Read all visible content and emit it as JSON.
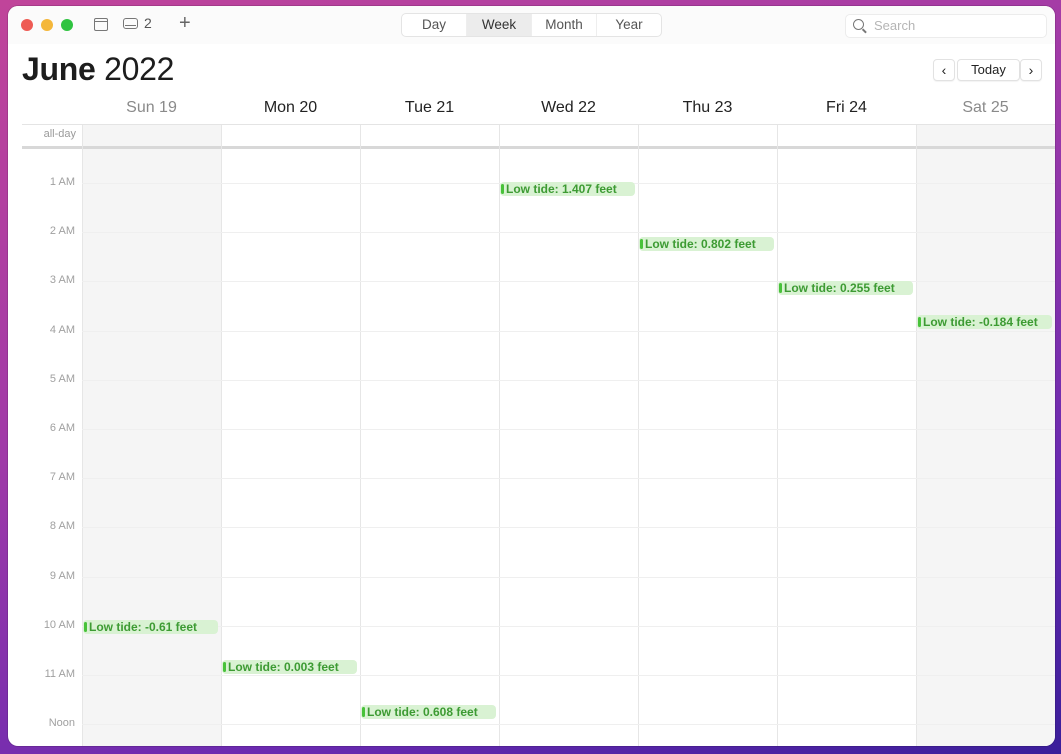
{
  "toolbar": {
    "inbox_count": "2",
    "add_label": "+",
    "icons": {
      "close": "close-traffic-light",
      "minimize": "minimize-traffic-light",
      "maximize": "zoom-traffic-light",
      "calendars": "calendar-list-icon",
      "inbox": "inbox-tray-icon",
      "add": "plus-icon",
      "search": "magnifying-glass-icon"
    },
    "views": [
      {
        "label": "Day",
        "active": false
      },
      {
        "label": "Week",
        "active": true
      },
      {
        "label": "Month",
        "active": false
      },
      {
        "label": "Year",
        "active": false
      }
    ],
    "search_placeholder": "Search"
  },
  "header": {
    "month": "June",
    "year": "2022",
    "prev_label": "‹",
    "today_label": "Today",
    "next_label": "›"
  },
  "week": {
    "days": [
      {
        "label": "Sun 19",
        "weekend": true
      },
      {
        "label": "Mon 20",
        "weekend": false
      },
      {
        "label": "Tue 21",
        "weekend": false
      },
      {
        "label": "Wed 22",
        "weekend": false
      },
      {
        "label": "Thu 23",
        "weekend": false
      },
      {
        "label": "Fri 24",
        "weekend": false
      },
      {
        "label": "Sat 25",
        "weekend": true
      }
    ],
    "allday_label": "all-day",
    "hours": [
      "1 AM",
      "2 AM",
      "3 AM",
      "4 AM",
      "5 AM",
      "6 AM",
      "7 AM",
      "8 AM",
      "9 AM",
      "10 AM",
      "11 AM",
      "Noon"
    ]
  },
  "events": [
    {
      "day": 0,
      "start_hour": 9.95,
      "title": "Low tide: -0.61 feet"
    },
    {
      "day": 1,
      "start_hour": 10.75,
      "title": "Low tide: 0.003 feet"
    },
    {
      "day": 2,
      "start_hour": 11.67,
      "title": "Low tide: 0.608 feet"
    },
    {
      "day": 3,
      "start_hour": 1.05,
      "title": "Low tide: 1.407 feet"
    },
    {
      "day": 4,
      "start_hour": 2.15,
      "title": "Low tide: 0.802 feet"
    },
    {
      "day": 5,
      "start_hour": 3.05,
      "title": "Low tide: 0.255 feet"
    },
    {
      "day": 6,
      "start_hour": 3.75,
      "title": "Low tide: -0.184 feet"
    }
  ],
  "colors": {
    "event_bg": "#d9f2d3",
    "event_text": "#3d9b33",
    "event_bar": "#48c23a"
  }
}
